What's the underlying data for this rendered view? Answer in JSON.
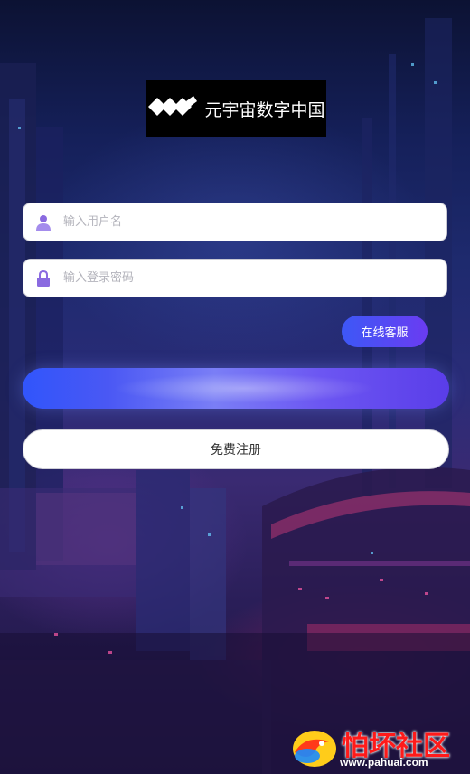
{
  "brand": {
    "logo_text": "元宇宙数字中国"
  },
  "login_form": {
    "username_placeholder": "输入用户名",
    "password_placeholder": "输入登录密码",
    "service_button": "在线客服",
    "login_button": "",
    "register_button": "免费注册"
  },
  "watermark": {
    "name": "怕坏社区",
    "url": "www.pahuai.com"
  },
  "icons": {
    "username": "user-icon",
    "password": "lock-icon"
  },
  "colors": {
    "accent_start": "#3155fb",
    "accent_end": "#6a3cf2",
    "icon_purple": "#8a6ae0",
    "watermark_red": "#ff1a1a"
  }
}
